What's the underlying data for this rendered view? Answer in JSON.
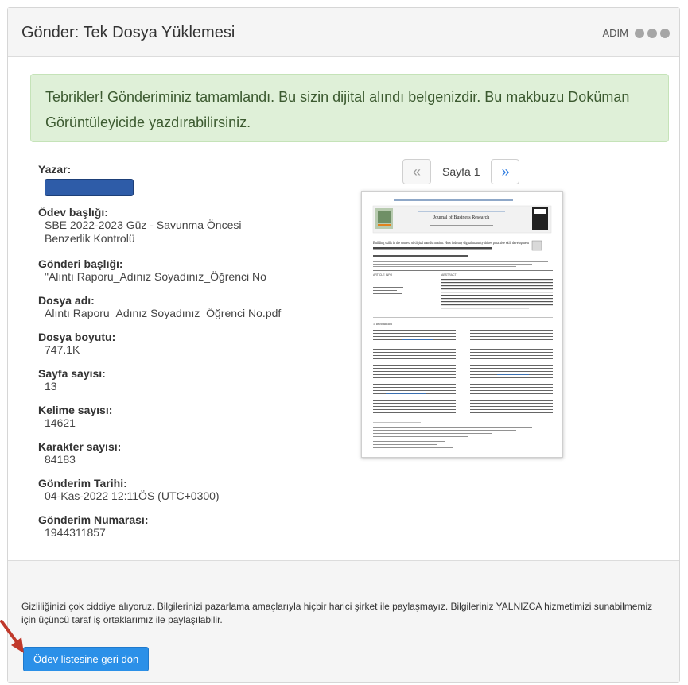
{
  "header": {
    "title": "Gönder: Tek Dosya Yüklemesi",
    "steps_label": "ADIM"
  },
  "alert": {
    "message": "Tebrikler! Gönderiminiz tamamlandı. Bu sizin dijital alındı belgenizdir. Bu makbuzu Doküman Görüntüleyicide yazdırabilirsiniz."
  },
  "meta": {
    "author_label": "Yazar:",
    "assignment_title_label": "Ödev başlığı:",
    "assignment_title": "SBE 2022-2023 Güz - Savunma Öncesi Benzerlik Kontrolü",
    "submission_title_label": "Gönderi başlığı:",
    "submission_title": "\"Alıntı Raporu_Adınız Soyadınız_Öğrenci No",
    "file_name_label": "Dosya adı:",
    "file_name": "Alıntı Raporu_Adınız Soyadınız_Öğrenci No.pdf",
    "file_size_label": "Dosya boyutu:",
    "file_size": "747.1K",
    "page_count_label": "Sayfa sayısı:",
    "page_count": "13",
    "word_count_label": "Kelime sayısı:",
    "word_count": "14621",
    "char_count_label": "Karakter sayısı:",
    "char_count": "84183",
    "date_label": "Gönderim Tarihi:",
    "date": "04-Kas-2022 12:11ÖS (UTC+0300)",
    "id_label": "Gönderim Numarası:",
    "id": "1944311857"
  },
  "pager": {
    "prev": "«",
    "label": "Sayfa 1",
    "next": "»"
  },
  "preview": {
    "journal": "Journal of Business Research",
    "paper_title": "Building skills in the context of digital transformation: How industry digital maturity drives proactive skill development",
    "abstract_label": "ABSTRACT",
    "article_info_label": "ARTICLE INFO",
    "intro_heading": "1. Introduction"
  },
  "footer": {
    "privacy": "Gizliliğinizi çok ciddiye alıyoruz. Bilgilerinizi pazarlama amaçlarıyla hiçbir harici şirket ile paylaşmayız. Bilgileriniz YALNIZCA hizmetimizi sunabilmemiz için üçüncü taraf iş ortaklarımız ile paylaşılabilir.",
    "back_button": "Ödev listesine geri dön"
  },
  "colors": {
    "alert_bg": "#dff0d8",
    "button": "#2b90e8",
    "next_arrow": "#2d7be0",
    "annotation_arrow": "#c0392b"
  }
}
